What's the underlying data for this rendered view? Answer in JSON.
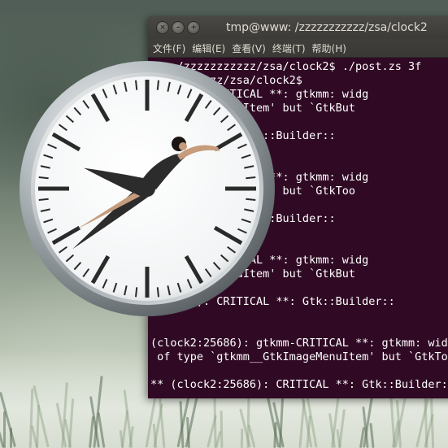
{
  "terminal": {
    "title": "tmp@www: /zzzzzzzzzzz/zsa/clock2",
    "buttons": {
      "close": "×",
      "minimize": "–",
      "maximize": "+"
    },
    "menu": [
      "文件(F)",
      "编辑(E)",
      "查看(V)",
      "终端(T)",
      "帮助(H)"
    ],
    "lines": [
      "www:/zzzzzzzzzzz/zsa/clock2$ ./post.zs 3f",
      "zzzzzzzzzzz/zsa/clock2$",
      "): gtkmm-CRITICAL **: gtkmm: widg",
      "__GtkImageMenuItem' but `GtkBut",
      "",
      " CRITICAL **: Gtk::Builder::",
      "",
      "",
      "): gtkmm-CRITICAL **: gtkmm: widg",
      "__GtkImageMenuItem' but `GtkToo",
      "",
      " CRITICAL **: Gtk::Builder::",
      "",
      "",
      "): gtkmm-CRITICAL **: gtkmm: widg",
      "__GtkImageMenuItem' but `GtkBut",
      "",
      "2:25686): CRITICAL **: Gtk::Builder::",
      "",
      "",
      "(clock2:25686): gtkmm-CRITICAL **: gtkmm: widg",
      " of type `gtkmm__GtkImageMenuItem' but `GtkToo",
      "",
      "** (clock2:25686): CRITICAL **: Gtk::Builder::"
    ]
  },
  "clock": {
    "hour_value": 7.7,
    "minute_value": 48,
    "second_value": 40,
    "colors": {
      "face": "#ffffff",
      "marks": "#2a2a2a",
      "bezel": "#9aa0a3",
      "figure": "#2c2c2c",
      "skin": "#c69c7c"
    }
  }
}
